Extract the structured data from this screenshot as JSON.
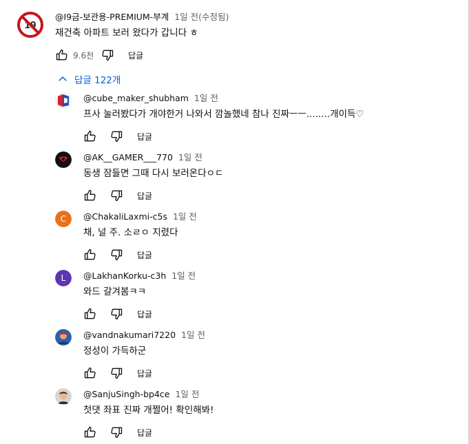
{
  "main": {
    "author": "@I9금-보관용-PREMIUM-부계",
    "time": "1일 전(수정됨)",
    "text": "재건축 아파트 보러 왔다가 갑니다 ㅎ",
    "likes": "9.6천",
    "reply_label": "답글"
  },
  "replies_toggle": {
    "label": "답글 122개"
  },
  "replies": [
    {
      "author": "@cube_maker_shubham",
      "time": "1일 전",
      "text": "프사 눌러봤다가 개야한거 나와서 깜놀했네 참나 진짜ㅡㅡ........개이득♡",
      "reply_label": "답글"
    },
    {
      "author": "@AK__GAMER___770",
      "time": "1일 전",
      "text": "동생 잠들면 그때 다시 보러온다ㅇㄷ",
      "reply_label": "답글"
    },
    {
      "author": "@ChakaliLaxmi-c5s",
      "time": "1일 전",
      "text": "채, 널 주. 소ㄹㅇ 지렸다",
      "reply_label": "답글",
      "initial": "C"
    },
    {
      "author": "@LakhanKorku-c3h",
      "time": "1일 전",
      "text": "와드 갈겨봄ㅋㅋ",
      "reply_label": "답글",
      "initial": "L"
    },
    {
      "author": "@vandnakumari7220",
      "time": "1일 전",
      "text": "정성이 가득하군",
      "reply_label": "답글"
    },
    {
      "author": "@SanjuSingh-bp4ce",
      "time": "1일 전",
      "text": "첫댓 좌표 진짜 개쩔어! 확인해봐!",
      "reply_label": "답글"
    }
  ],
  "colors": {
    "link_blue": "#065fd4",
    "avatar_orange": "#e8711c",
    "avatar_purple": "#5e35b1"
  }
}
